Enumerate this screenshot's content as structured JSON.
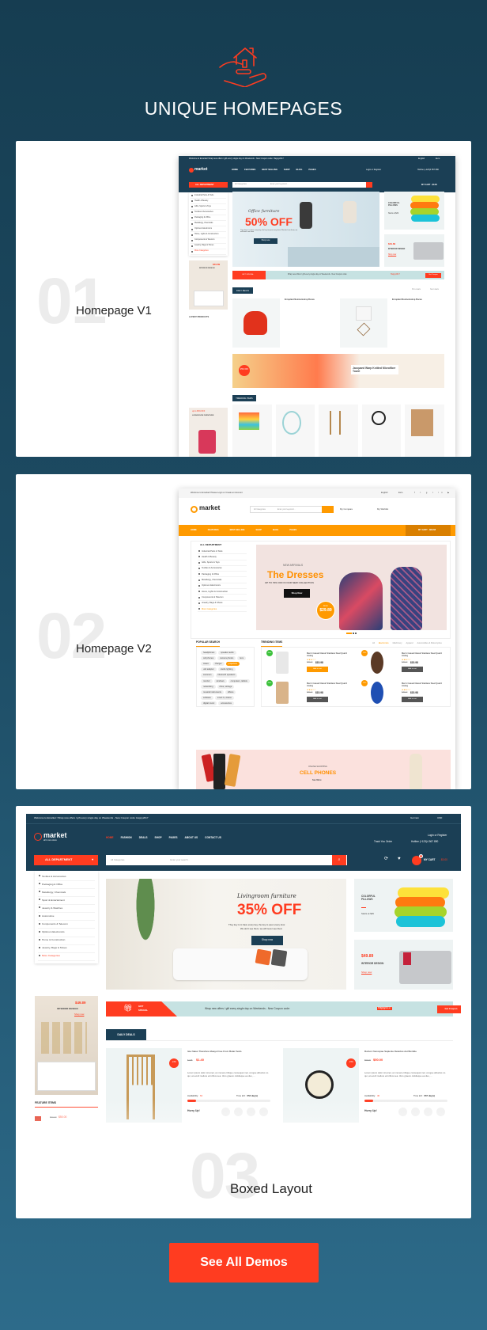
{
  "header": {
    "title": "UNIQUE HOMEPAGES",
    "icon": "hand-house-icon",
    "accent": "#ff3c20"
  },
  "demos": [
    {
      "number": "01",
      "label": "Homepage V1"
    },
    {
      "number": "02",
      "label": "Homepage V2"
    },
    {
      "number": "03",
      "label": "Boxed Layout"
    }
  ],
  "cta": {
    "label": "See All Demos"
  },
  "v1": {
    "topbar": "Welcome to Emarket! Wrap new offers / gift every single day on Weekends - New Coupon code: Happy2017",
    "lang": "English",
    "currency": "Euro",
    "logo": "market",
    "tagline": "all in one store",
    "nav": [
      "HOME",
      "FEATURES",
      "BEST SELLING",
      "SHOP",
      "BLOG",
      "PAGES"
    ],
    "login": "Login or Register",
    "track": "Track Your Order",
    "hotline": "Hotline (+123)4 567 890",
    "dept": "ALL DEPARTMENT",
    "search_cat": "All Categories",
    "search_ph": "Enter your keyword...",
    "cart": "MY CART - $0.00",
    "categories": [
      "Industrial Parts & Tools",
      "Health & Beauty",
      "Gifts, Sports & Toys",
      "Textiles & Accessories",
      "Packaging & Office",
      "Metallurgy, Chemicals",
      "Optimum Electronics",
      "Home, Lights & Construction",
      "Components & Telecom",
      "Jewelry, Bags & Shoes",
      "More Categories"
    ],
    "banner": {
      "script": "Office furniture",
      "offer": "50% OFF",
      "text": "They key is to have every key, the key to open every door. We don't see them, we will never see them",
      "button": "Shop now"
    },
    "side1": {
      "title": "COLORFUL PILLOWS",
      "sub": "Starts at $29"
    },
    "side2": {
      "price": "$49.89",
      "title": "INTERIOR DESIGN",
      "link": "Shop now"
    },
    "leftad": {
      "price": "$49.89",
      "title": "INTERIOR DESIGN",
      "link": "Shop now"
    },
    "gift": {
      "label": "GIFT SPECIAL",
      "text": "Wrap new offers / gift every single day on Weekends - New Coupon code:",
      "code": "Happy2017",
      "button": "Get Coupon"
    },
    "deals_title": "DAILY DEALS",
    "prev": "Prev deals",
    "next": "Next deals",
    "deal_name": "Ercoptant Nomnomstrop Bocus",
    "latest": "LATEST PRODUCTS",
    "towel": "Jacquard Warp Knitted Microfiber Towel",
    "towel_off": "25% OFF",
    "trending": "TRENDING ITEMS",
    "bottomad": {
      "title": "up to 60% OFF",
      "sub": "LIVINGROOM FURNITURE"
    }
  },
  "v2": {
    "topbar": "Welcome to Emarket! Please Login or Create an Account",
    "lang": "English",
    "currency": "Euro",
    "logo": "market",
    "search_cat": "All Categories",
    "search_ph": "Enter your keyword...",
    "compare": "My Compare",
    "wishlist": "My Wishlist",
    "nav": [
      "HOME",
      "FEATURES",
      "BEST-SELLING",
      "SHOP",
      "BLOG",
      "PAGES"
    ],
    "cart": "MY CART - $69.68",
    "dept": "ALL DEPARTMENT",
    "categories": [
      "Industrial Parts & Tools",
      "Health & Beauty",
      "Gifts, Sports & Toys",
      "Textiles & Accessories",
      "Packaging & Office",
      "Metallurgy, Chemicals",
      "Optimum Electronics",
      "Home, Lights & Construction",
      "Components & Telecom",
      "Jewelry, Bags & Shoes",
      "More Categories"
    ],
    "banner": {
      "kicker": "NEW ARRIVALS",
      "title": "The Dresses",
      "sub": "UP TO 70% OFF IN OUR NEW COLLECTION",
      "button": "Shop Now",
      "from": "From",
      "price": "$29.89"
    },
    "popular": "POPULAR SEARCH",
    "tags": [
      "headphones",
      "speaker audio",
      "cell phones",
      "camera photos",
      "lens",
      "cases",
      "charger",
      "projectors",
      "usb adapter",
      "studio lighting",
      "scanners",
      "bluetooth speakers",
      "monitor",
      "windows",
      "computers, tablets",
      "networking",
      "drive, storage",
      "musical instruments",
      "offices",
      "software",
      "smart tv, videos",
      "digital music",
      "accessories"
    ],
    "trending": "TRENDING ITEMS",
    "tabs": [
      "All",
      "Electronics",
      "Machinery",
      "Apparel",
      "Automobiles & Motorcycles"
    ],
    "products": [
      {
        "name": "Men's Casual Classic Stainless Steel Quartz Analog",
        "old": "$25.00",
        "price": "$15.98",
        "badge": "New",
        "button": "Add to cart"
      },
      {
        "name": "Men's Casual Classic Stainless Steel Quartz Analog",
        "old": "$25.00",
        "price": "$15.98",
        "badge": "70%",
        "button": "Add to cart"
      },
      {
        "name": "Men's Casual Classic Stainless Steel Quartz Analog",
        "old": "$25.00",
        "price": "$15.98",
        "badge": "New",
        "button": "Add to cart"
      },
      {
        "name": "Men's Casual Classic Stainless Steel Quartz Analog",
        "old": "$25.00",
        "price": "$15.98",
        "badge": "70%",
        "button": "Add to cart"
      }
    ],
    "promo": {
      "kicker": "ONLINE SHOPPING",
      "title": "CELL PHONES",
      "link": "See More"
    }
  },
  "v3": {
    "topbar": "Welcome to Emarket ! Wrap new offers / gift every single day on Weekends - New Coupon code: Happy2017",
    "lang": "German",
    "currency": "USD",
    "logo": "market",
    "tagline": "all in one store",
    "nav": [
      "HOME",
      "FASHION",
      "DEALS",
      "SHOP",
      "PAGES",
      "ABOUT US",
      "CONTACT US"
    ],
    "login": "Login or Register",
    "track": "Track You Order",
    "hotline": "Hotline (+123)4 567 890",
    "dept": "ALL DEPARTMENT",
    "search_cat": "All Categories",
    "search_ph": "Enter your search...",
    "cart_count": "0",
    "cart": "MY CART",
    "cart_total": "- $0.00",
    "categories": [
      "Textiles & Accessories",
      "Packaging & Office",
      "Metallurgy, Chemicals",
      "Sport & Entertaiment",
      "Jewelry & Watches",
      "Automotive",
      "Components & Telecom",
      "Optimum Electronics",
      "Home & Construction",
      "Jewelry, Bags & Shoes",
      "More Categories"
    ],
    "banner": {
      "script": "Livingroom furniture",
      "offer": "35% OFF",
      "line1": "They key is to have every key, the key to open every door.",
      "line2": "We don't see them, we will never see them",
      "button": "Shop now"
    },
    "side1": {
      "title": "COLORFUL PILLOWS",
      "sub": "Starts at $29"
    },
    "side2": {
      "price": "$49.89",
      "title": "INTERIOR DESIGN",
      "link": "Shop now"
    },
    "leftad": {
      "price": "$49.89",
      "title": "INTERIOR DESIGN",
      "link": "Shop now"
    },
    "feature": {
      "title": "FEATURE ITEMS",
      "old": "$60.00",
      "price": "$50.00"
    },
    "gift": {
      "label1": "GIFT",
      "label2": "SPECIAL",
      "text": "Wrap new offers / gift every single day on Weekends - New Coupon code:",
      "code": "Happy2017",
      "button": "Get Coupon"
    },
    "deals_title": "DAILY DEALS",
    "deals": [
      {
        "name": "Iste Natus Therefore Always Free From Bolac Sodo",
        "old": "$1.85",
        "price": "$1.40",
        "badge": "-24%",
        "desc": "Lorem ipsum dolor sit amet, an munere tibique consequat mel, congue albucius no qui, at everti meliore erroribus sea. Vero graeco cotidieque ea duo, ...",
        "avail_label": "Availability:",
        "avail": "64",
        "time_label": "Time left:",
        "time": "653 day(s)",
        "hurry": "Hurry Up!",
        "progress": 0.1
      },
      {
        "name": "Rutrum Nonvopae Sapiente Delectus Aut Bonbde",
        "old": "$59.00",
        "price": "$50.00",
        "badge": "-15%",
        "desc": "Lorem ipsum dolor sit amet, an munere tibique consequat mel, congue albucius no qui, at everti meliore erroribus sea. Vero graeco cotidieque ea duo, ...",
        "avail_label": "Availability:",
        "avail": "40",
        "time_label": "Time left:",
        "time": "667 day(s)",
        "hurry": "Hurry Up!",
        "progress": 0.1
      }
    ]
  }
}
